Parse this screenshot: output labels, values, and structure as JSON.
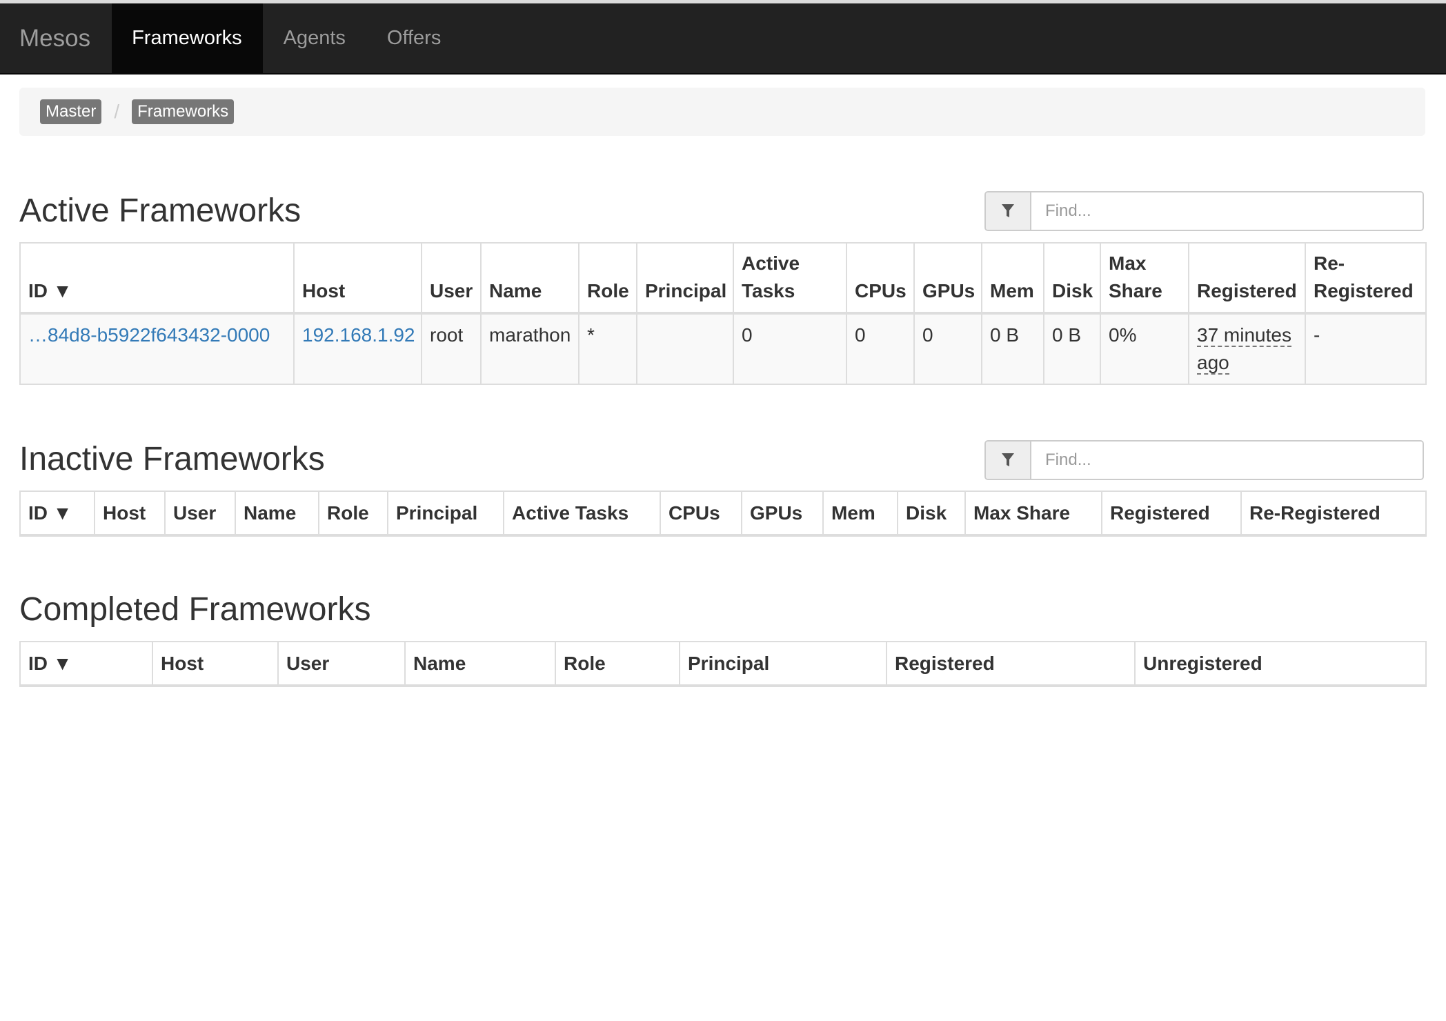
{
  "navbar": {
    "brand": "Mesos",
    "links": [
      {
        "label": "Frameworks",
        "active": true
      },
      {
        "label": "Agents",
        "active": false
      },
      {
        "label": "Offers",
        "active": false
      }
    ]
  },
  "breadcrumb": {
    "items": [
      "Master",
      "Frameworks"
    ],
    "separator": "/"
  },
  "active": {
    "title": "Active Frameworks",
    "filter_placeholder": "Find...",
    "headers": [
      "ID ▼",
      "Host",
      "User",
      "Name",
      "Role",
      "Principal",
      "Active Tasks",
      "CPUs",
      "GPUs",
      "Mem",
      "Disk",
      "Max Share",
      "Registered",
      "Re-Registered"
    ],
    "rows": [
      {
        "id": "…84d8-b5922f643432-0000",
        "host": "192.168.1.92",
        "user": "root",
        "name": "marathon",
        "role": "*",
        "principal": "",
        "active_tasks": "0",
        "cpus": "0",
        "gpus": "0",
        "mem": "0 B",
        "disk": "0 B",
        "max_share": "0%",
        "registered": "37 minutes ago",
        "reregistered": "-"
      }
    ]
  },
  "inactive": {
    "title": "Inactive Frameworks",
    "filter_placeholder": "Find...",
    "headers": [
      "ID ▼",
      "Host",
      "User",
      "Name",
      "Role",
      "Principal",
      "Active Tasks",
      "CPUs",
      "GPUs",
      "Mem",
      "Disk",
      "Max Share",
      "Registered",
      "Re-Registered"
    ]
  },
  "completed": {
    "title": "Completed Frameworks",
    "headers": [
      "ID ▼",
      "Host",
      "User",
      "Name",
      "Role",
      "Principal",
      "Registered",
      "Unregistered"
    ]
  },
  "colors": {
    "navbar_bg": "#222222",
    "link": "#337ab7",
    "crumb_bg": "#777777"
  }
}
